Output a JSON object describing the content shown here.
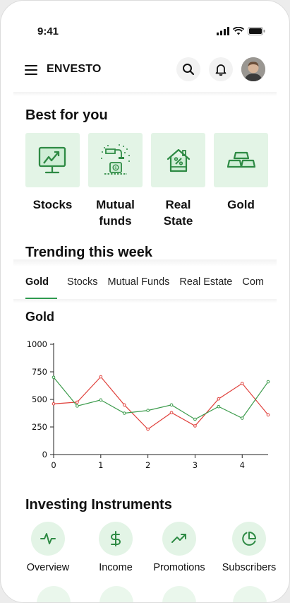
{
  "status_bar": {
    "time": "9:41"
  },
  "header": {
    "brand": "ENVESTO"
  },
  "best_for_you": {
    "title": "Best for you",
    "items": [
      {
        "label": "Stocks",
        "icon": "stocks-chart-icon"
      },
      {
        "label": "Mutual\nfunds",
        "icon": "mutual-funds-icon"
      },
      {
        "label": "Real\nState",
        "icon": "real-estate-house-icon"
      },
      {
        "label": "Gold",
        "icon": "gold-bars-icon"
      }
    ]
  },
  "trending": {
    "title": "Trending this week",
    "tabs": [
      "Gold",
      "Stocks",
      "Mutual Funds",
      "Real Estate",
      "Com"
    ],
    "active_tab": "Gold"
  },
  "chart_data": {
    "type": "line",
    "title": "Gold",
    "xlabel": "",
    "ylabel": "",
    "x_ticks": [
      0,
      1,
      2,
      3,
      4
    ],
    "y_ticks": [
      0,
      250,
      500,
      750,
      1000
    ],
    "xlim": [
      0,
      4.55
    ],
    "ylim": [
      0,
      1000
    ],
    "grid": false,
    "colors": {
      "red": "#e0413c",
      "green": "#3a9a4a"
    },
    "series": [
      {
        "color": "red",
        "x": [
          0,
          0.5,
          1.0,
          1.5,
          2.0,
          2.5,
          3.0,
          3.5,
          4.0,
          4.55
        ],
        "y": [
          460,
          475,
          705,
          450,
          230,
          380,
          260,
          505,
          645,
          360
        ]
      },
      {
        "color": "green",
        "x": [
          0,
          0.5,
          1.0,
          1.5,
          2.0,
          2.5,
          3.0,
          3.5,
          4.0,
          4.55
        ],
        "y": [
          700,
          440,
          495,
          375,
          400,
          450,
          320,
          435,
          330,
          660
        ]
      }
    ]
  },
  "instruments": {
    "title": "Investing Instruments",
    "items": [
      {
        "label": "Overview",
        "icon": "activity-pulse-icon"
      },
      {
        "label": "Income",
        "icon": "dollar-sign-icon"
      },
      {
        "label": "Promotions",
        "icon": "trending-up-icon"
      },
      {
        "label": "Subscribers",
        "icon": "pie-chart-icon"
      }
    ]
  }
}
